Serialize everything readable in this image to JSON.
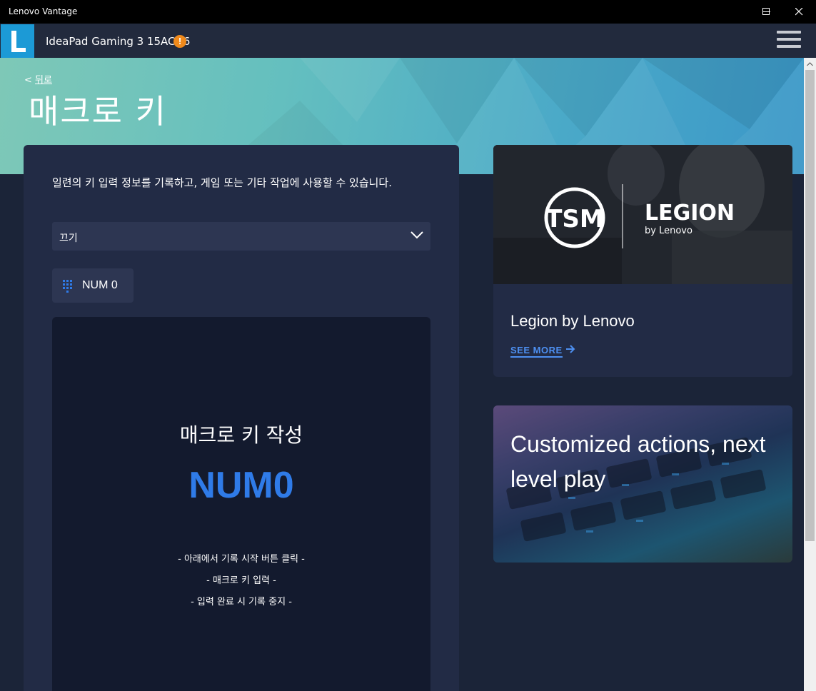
{
  "window": {
    "title": "Lenovo Vantage"
  },
  "appbar": {
    "device_name": "IdeaPad Gaming 3 15ACH6",
    "warning_glyph": "!",
    "logo_letter": "L"
  },
  "header": {
    "back_label": "뒤로",
    "back_prefix": "< ",
    "page_title": "매크로 키"
  },
  "macro": {
    "description": "일련의 키 입력 정보를 기록하고, 게임 또는 기타 작업에 사용할 수 있습니다.",
    "dropdown_value": "끄기",
    "selected_key_label": "NUM 0",
    "panel_title": "매크로 키 작성",
    "panel_key": "NUM0",
    "instructions": [
      "- 아래에서 기록 시작 버튼 클릭 -",
      "- 매크로 키 입력 -",
      "- 입력 완료 시 기록 중지 -"
    ]
  },
  "cards": {
    "legion": {
      "caption": "Legion by Lenovo",
      "link_label": "SEE MORE",
      "logo_brand": "LEGION",
      "logo_sub": "by Lenovo",
      "team_logo": "TSM"
    },
    "promo": {
      "text": "Customized actions, next level play"
    }
  },
  "colors": {
    "accent": "#2f7be8",
    "link": "#4d8ff0",
    "warning": "#f08a1c",
    "logo_bg": "#1c9ad6",
    "panel": "#222b45",
    "page_bg": "#1b2438"
  },
  "icons": {
    "minimize": "minimize-icon",
    "maximize": "maximize-icon",
    "close": "close-icon",
    "menu": "hamburger-menu-icon",
    "dropdown": "chevron-down-icon",
    "keypad": "keypad-icon",
    "arrow": "arrow-right-icon"
  }
}
